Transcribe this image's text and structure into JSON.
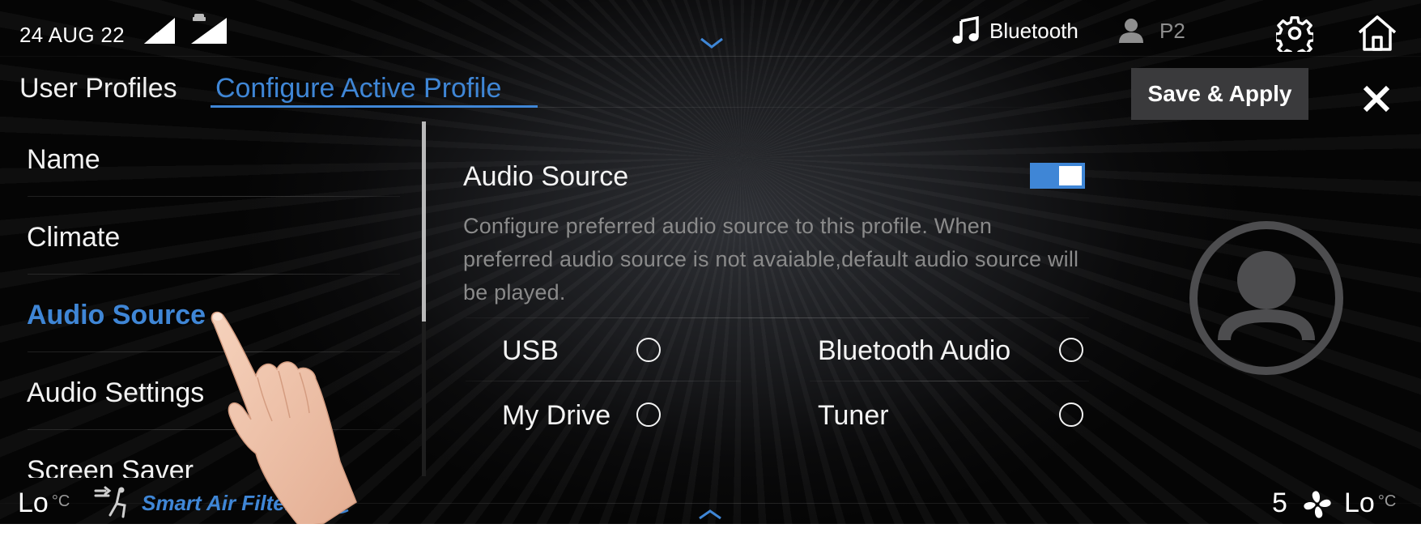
{
  "status_bar": {
    "date": "24 AUG 22",
    "signal_icons": [
      "cellular-signal-icon",
      "car-signal-icon"
    ],
    "media_source": "Bluetooth",
    "media_icon": "music-note-icon",
    "profile_label": "P2",
    "profile_icon": "person-icon",
    "settings_icon": "gear-icon",
    "home_icon": "home-icon",
    "pulldown_icon": "chevron-down-icon"
  },
  "tabs": [
    {
      "label": "User Profiles",
      "active": false
    },
    {
      "label": "Configure Active Profile",
      "active": true
    }
  ],
  "actions": {
    "save_label": "Save & Apply",
    "close_icon": "close-icon"
  },
  "menu": {
    "items": [
      {
        "label": "Name",
        "active": false
      },
      {
        "label": "Climate",
        "active": false
      },
      {
        "label": "Audio Source",
        "active": true
      },
      {
        "label": "Audio Settings",
        "active": false
      },
      {
        "label": "Screen Saver",
        "active": false
      }
    ]
  },
  "panel": {
    "title": "Audio Source",
    "toggle_on": true,
    "description": "Configure preferred audio source to this profile. When preferred audio source is not avaiable,default audio source will be played.",
    "options": [
      {
        "label": "USB",
        "selected": false
      },
      {
        "label": "Bluetooth Audio",
        "selected": false
      },
      {
        "label": "My Drive",
        "selected": false
      },
      {
        "label": "Tuner",
        "selected": false
      }
    ],
    "avatar_icon": "profile-avatar-icon"
  },
  "climate_bar": {
    "left_temp": "Lo",
    "left_unit": "°C",
    "seat_icon": "seat-airflow-icon",
    "smart_air_filter": "Smart Air Filter",
    "filter_icon": "air-filter-icon",
    "pullup_icon": "chevron-up-icon",
    "fan_speed": "5",
    "fan_icon": "fan-icon",
    "right_temp": "Lo",
    "right_unit": "°C"
  },
  "overlay": {
    "hand_icon": "tap-hand-icon"
  },
  "colors": {
    "accent": "#3f86d6",
    "background": "#0b0b0c",
    "button": "#3a3a3c",
    "muted_text": "#8a8a8a"
  }
}
